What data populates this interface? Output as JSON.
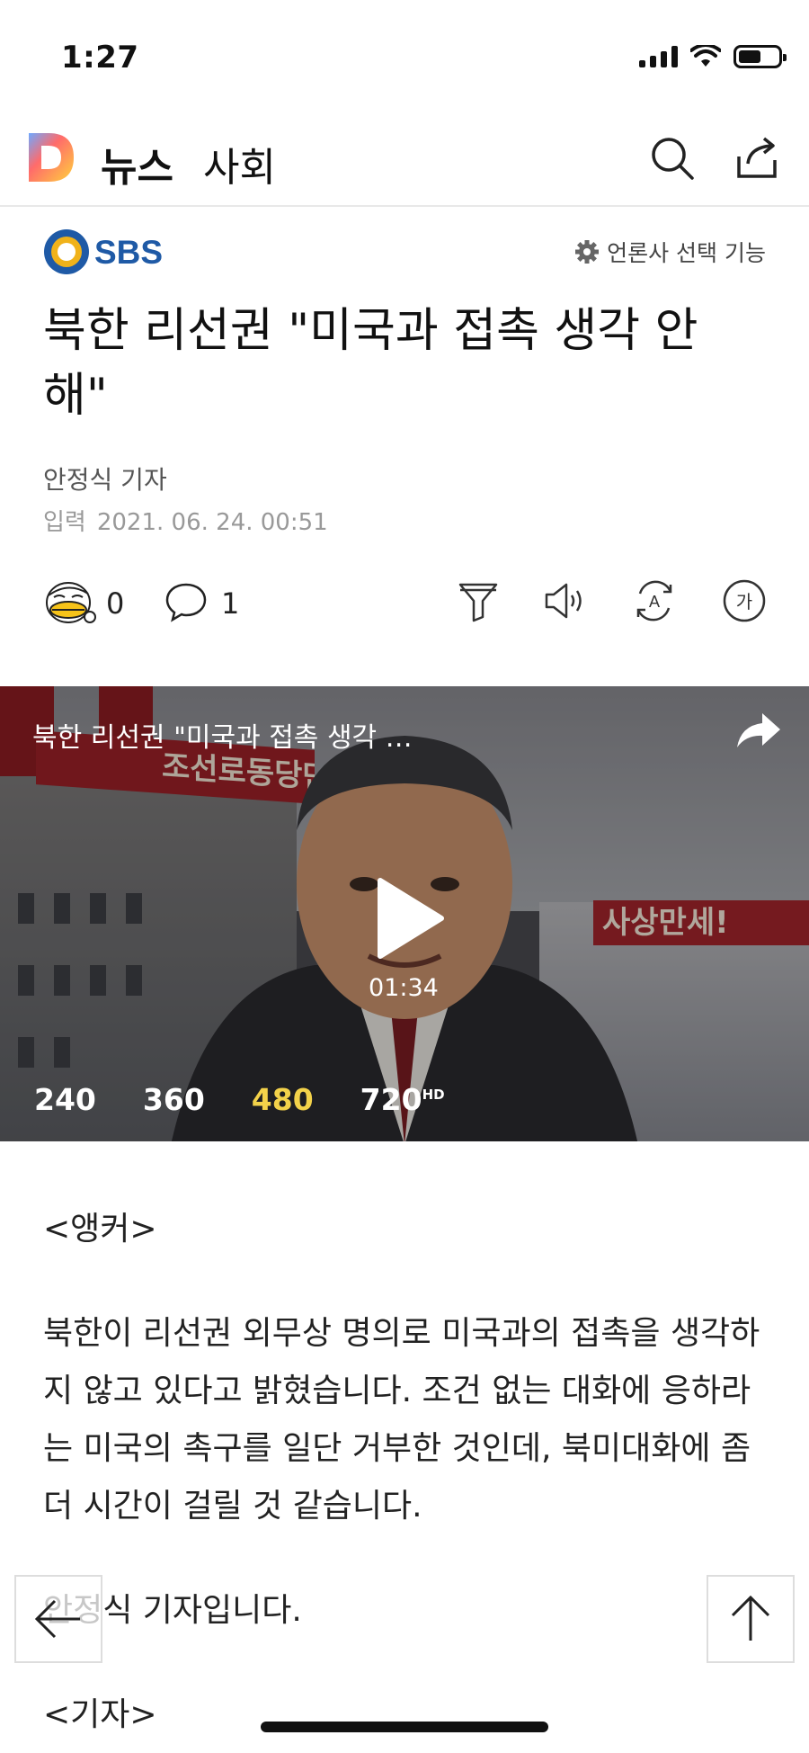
{
  "status_bar": {
    "time": "1:27"
  },
  "header": {
    "title": "뉴스",
    "section": "사회"
  },
  "press": {
    "name": "SBS",
    "select_label": "언론사 선택 기능"
  },
  "article": {
    "headline": "북한 리선권 \"미국과 접촉 생각 안 해\"",
    "reporter": "안정식 기자",
    "posted_label": "입력",
    "posted_time": "2021. 06. 24. 00:51",
    "reaction_count": "0",
    "comment_count": "1",
    "paragraphs": [
      "<앵커>",
      "북한이 리선권 외무상 명의로 미국과의 접촉을 생각하지 않고 있다고 밝혔습니다. 조건 없는 대화에 응하라는 미국의 촉구를 일단 거부한 것인데, 북미대화에 좀 더 시간이 걸릴 것 같습니다.",
      "안정식 기자입니다.",
      "<기자>"
    ]
  },
  "video": {
    "title": "북한 리선권 \"미국과 접촉 생각 …",
    "duration": "01:34",
    "qualities": [
      "240",
      "360",
      "480",
      "720"
    ],
    "quality_suffix": "HD",
    "selected_quality": "480",
    "banner_left": "조선로동당만세!",
    "banner_right": "사상만세!"
  },
  "colors": {
    "accent_quality": "#f3d24a",
    "sbs_blue": "#1f5aa6",
    "sbs_gold": "#f0b21a"
  },
  "icons": {
    "header": [
      "daum-logo",
      "search-icon",
      "share-icon"
    ],
    "tools": [
      "filter-icon",
      "speaker-icon",
      "translate-icon",
      "font-size-icon"
    ],
    "float": [
      "back-arrow-icon",
      "up-arrow-icon"
    ]
  }
}
